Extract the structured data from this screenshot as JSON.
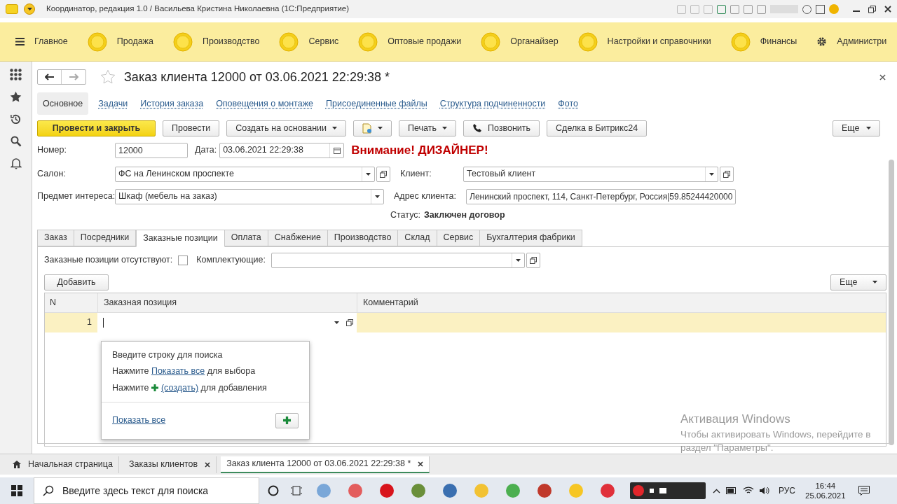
{
  "window": {
    "title": "Координатор, редакция 1.0 / Васильева Кристина Николаевна  (1С:Предприятие)"
  },
  "sections": [
    {
      "label": "Главное",
      "kind": "menu"
    },
    {
      "label": "Продажа",
      "kind": "circle"
    },
    {
      "label": "Производство",
      "kind": "circle"
    },
    {
      "label": "Сервис",
      "kind": "circle"
    },
    {
      "label": "Оптовые продажи",
      "kind": "circle"
    },
    {
      "label": "Органайзер",
      "kind": "circle"
    },
    {
      "label": "Настройки и справочники",
      "kind": "circle"
    },
    {
      "label": "Финансы",
      "kind": "circle"
    },
    {
      "label": "Администри",
      "kind": "gear"
    }
  ],
  "form": {
    "title": "Заказ клиента 12000 от 03.06.2021 22:29:38 *",
    "nav_links": [
      {
        "label": "Основное",
        "selected": true
      },
      {
        "label": "Задачи",
        "selected": false
      },
      {
        "label": "История заказа",
        "selected": false
      },
      {
        "label": "Оповещения о монтаже",
        "selected": false
      },
      {
        "label": "Присоединенные файлы",
        "selected": false
      },
      {
        "label": "Структура подчиненности",
        "selected": false
      },
      {
        "label": "Фото",
        "selected": false
      }
    ],
    "actions": [
      {
        "kind": "primary",
        "label": "Провести и закрыть"
      },
      {
        "kind": "plain",
        "label": "Провести"
      },
      {
        "kind": "dropdown",
        "label": "Создать на основании"
      },
      {
        "kind": "icon-dropdown"
      },
      {
        "kind": "dropdown",
        "label": "Печать"
      },
      {
        "kind": "phone",
        "label": "Позвонить"
      },
      {
        "kind": "plain",
        "label": "Сделка в Битрикс24"
      }
    ],
    "more_button": "Еще",
    "number": {
      "label": "Номер:",
      "value": "12000"
    },
    "date": {
      "label": "Дата:",
      "value": "03.06.2021 22:29:38"
    },
    "warning": "Внимание! ДИЗАЙНЕР!",
    "salon": {
      "label": "Салон:",
      "value": "ФС на Ленинском проспекте"
    },
    "client": {
      "label": "Клиент:",
      "value": "Тестовый клиент"
    },
    "subject": {
      "label": "Предмет интереса:",
      "value": "Шкаф (мебель на заказ)"
    },
    "address": {
      "label": "Адрес клиента:",
      "value": "Ленинский проспект, 114, Санкт-Петербург, Россия|59.85244420000"
    },
    "status": {
      "label": "Статус:",
      "value": "Заключен договор"
    },
    "tabs": [
      {
        "label": "Заказ",
        "selected": false
      },
      {
        "label": "Посредники",
        "selected": false
      },
      {
        "label": "Заказные позиции",
        "selected": true
      },
      {
        "label": "Оплата",
        "selected": false
      },
      {
        "label": "Снабжение",
        "selected": false
      },
      {
        "label": "Производство",
        "selected": false
      },
      {
        "label": "Склад",
        "selected": false
      },
      {
        "label": "Сервис",
        "selected": false
      },
      {
        "label": "Бухгалтерия фабрики",
        "selected": false
      }
    ],
    "missing": {
      "label": "Заказные позиции отсутствуют:",
      "checked": false
    },
    "components": {
      "label": "Комплектующие:"
    },
    "add_button": "Добавить",
    "table_more": "Еще",
    "table": {
      "columns": [
        "N",
        "Заказная позиция",
        "Комментарий"
      ],
      "rows": [
        {
          "n": "1",
          "selected": true
        }
      ]
    },
    "popup": {
      "lines": [
        {
          "before": "Введите строку для поиска"
        },
        {
          "before": "Нажмите ",
          "link": "Показать все",
          "after": " для выбора"
        },
        {
          "before": "Нажмите ",
          "plus": true,
          "link": "(создать)",
          "after": " для добавления"
        }
      ],
      "footer_link": "Показать все"
    }
  },
  "activation": {
    "title": "Активация Windows",
    "text": "Чтобы активировать Windows, перейдите в раздел \"Параметры\"."
  },
  "open_windows": [
    {
      "label": "Начальная страница",
      "kind": "home",
      "selected": false
    },
    {
      "label": "Заказы клиентов",
      "kind": "closable",
      "selected": false
    },
    {
      "label": "Заказ клиента 12000 от 03.06.2021 22:29:38 *",
      "kind": "closable",
      "selected": true
    }
  ],
  "taskbar": {
    "search_placeholder": "Введите здесь текст для поиска",
    "language": "РУС",
    "time": "16:44",
    "date": "25.06.2021"
  }
}
